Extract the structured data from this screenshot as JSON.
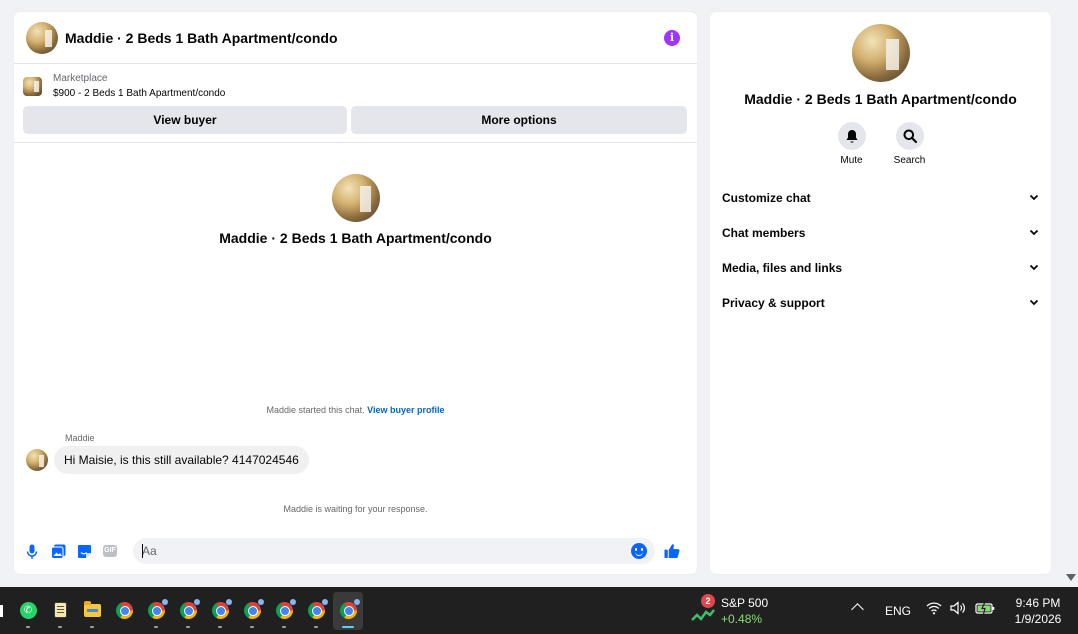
{
  "chat": {
    "title": "Maddie · 2 Beds 1 Bath Apartment/condo",
    "info_icon": "info-icon",
    "marketplace": {
      "label": "Marketplace",
      "listing": "$900 - 2 Beds 1 Bath Apartment/condo",
      "view_buyer_label": "View buyer",
      "more_options_label": "More options"
    },
    "intro_name": "Maddie · 2 Beds 1 Bath Apartment/condo",
    "started_text": "Maddie started this chat.",
    "view_profile_link": "View buyer profile",
    "sender_name": "Maddie",
    "message_text": "Hi Maisie, is this still available? 4147024546",
    "waiting_text": "Maddie is waiting for your response.",
    "composer": {
      "placeholder": "Aa",
      "icons": [
        "microphone-icon",
        "photo-icon",
        "sticker-icon",
        "gif-icon",
        "emoji-icon",
        "thumbs-up-icon"
      ]
    }
  },
  "info_panel": {
    "name": "Maddie · 2 Beds 1 Bath Apartment/condo",
    "actions": [
      {
        "label": "Mute",
        "icon": "bell-icon"
      },
      {
        "label": "Search",
        "icon": "search-icon"
      }
    ],
    "sections": [
      {
        "label": "Customize chat"
      },
      {
        "label": "Chat members"
      },
      {
        "label": "Media, files and links"
      },
      {
        "label": "Privacy & support"
      }
    ]
  },
  "taskbar": {
    "apps": [
      "whatsapp-icon",
      "notepad-icon",
      "file-explorer-icon",
      "chrome-icon",
      "chrome-icon",
      "chrome-icon",
      "chrome-icon",
      "chrome-icon",
      "chrome-icon",
      "chrome-icon",
      "chrome-icon"
    ],
    "stock": {
      "badge": "2",
      "name": "S&P 500",
      "change": "+0.48%"
    },
    "language": "ENG",
    "time": "9:46 PM",
    "date": "1/9/2026"
  },
  "colors": {
    "accent": "#0866ff",
    "info": "#a033ff",
    "link": "#0064d1",
    "stock_positive": "#8bd97c"
  }
}
